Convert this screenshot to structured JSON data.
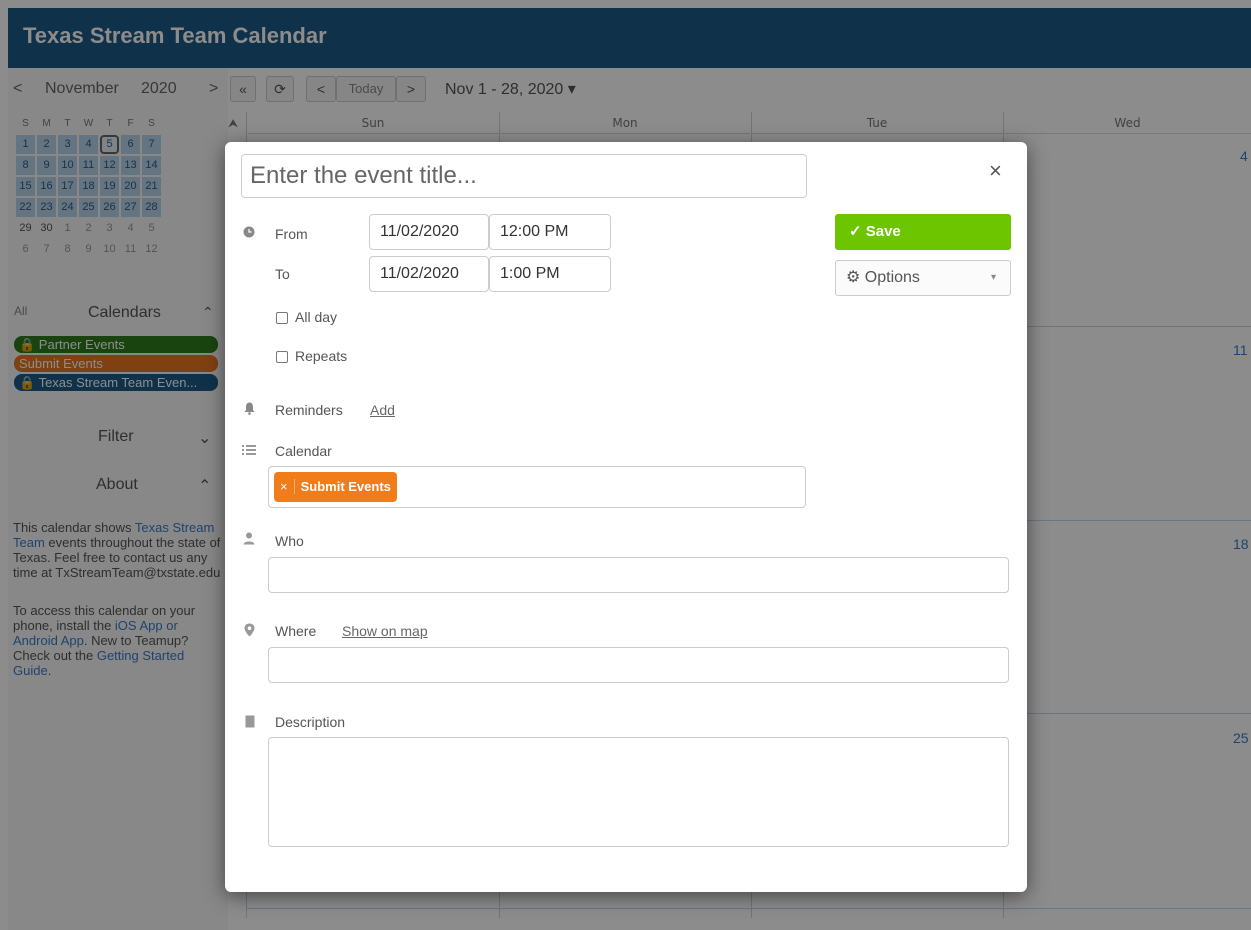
{
  "header": {
    "title": "Texas Stream Team Calendar"
  },
  "sidebar": {
    "mini_nav": {
      "prev": "<",
      "month": "November",
      "year": "2020",
      "next": ">"
    },
    "weekdays": [
      "S",
      "M",
      "T",
      "W",
      "T",
      "F",
      "S"
    ],
    "weeks": [
      [
        "1",
        "2",
        "3",
        "4",
        "5",
        "6",
        "7"
      ],
      [
        "8",
        "9",
        "10",
        "11",
        "12",
        "13",
        "14"
      ],
      [
        "15",
        "16",
        "17",
        "18",
        "19",
        "20",
        "21"
      ],
      [
        "22",
        "23",
        "24",
        "25",
        "26",
        "27",
        "28"
      ],
      [
        "29",
        "30",
        "1",
        "2",
        "3",
        "4",
        "5"
      ],
      [
        "6",
        "7",
        "8",
        "9",
        "10",
        "11",
        "12"
      ]
    ],
    "calendars": {
      "all_label": "All",
      "title": "Calendars",
      "items": [
        {
          "label": "🔒 Partner Events",
          "color": "#2f7d1e"
        },
        {
          "label": "Submit Events",
          "color": "#e87722"
        },
        {
          "label": "🔒 Texas Stream Team Even...",
          "color": "#1d5b87"
        }
      ]
    },
    "filter_label": "Filter",
    "about_label": "About",
    "about": {
      "p1_a": "This calendar shows ",
      "p1_link": "Texas Stream Team",
      "p1_b": " events throughout the state of Texas. Feel free to contact us any time at TxStreamTeam@txstate.edu",
      "p2_a": "To access this calendar on your phone, install the ",
      "p2_link1": "iOS App or Android App",
      "p2_b": ". New to Teamup? Check out the ",
      "p2_link2": "Getting Started Guide",
      "p2_c": "."
    }
  },
  "toolbar": {
    "back_double": "«",
    "refresh": "⟳",
    "prev": "<",
    "today": "Today",
    "next": ">",
    "range": "Nov 1 - 28, 2020 ▾"
  },
  "grid": {
    "days": [
      "Sun",
      "Mon",
      "Tue",
      "Wed"
    ],
    "week_starts": [
      "4",
      "11",
      "18",
      "25"
    ]
  },
  "modal": {
    "title_placeholder": "Enter the event title...",
    "close": "×",
    "from_label": "From",
    "to_label": "To",
    "from_date": "11/02/2020",
    "from_time": "12:00 PM",
    "to_date": "11/02/2020",
    "to_time": "1:00 PM",
    "all_day_label": "All day",
    "repeats_label": "Repeats",
    "reminders_label": "Reminders",
    "reminders_add": "Add",
    "calendar_label": "Calendar",
    "calendar_tag": "Submit Events",
    "calendar_tag_remove": "×",
    "who_label": "Who",
    "where_label": "Where",
    "where_link": "Show on map",
    "description_label": "Description",
    "save_label": "✓ Save",
    "options_label": "⚙ Options",
    "options_caret": "▾"
  }
}
